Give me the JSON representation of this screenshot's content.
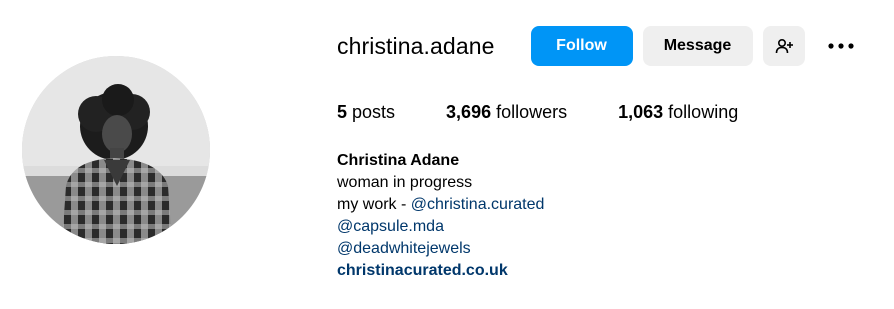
{
  "profile": {
    "username": "christina.adane",
    "display_name": "Christina Adane"
  },
  "actions": {
    "follow_label": "Follow",
    "message_label": "Message",
    "suggest_icon": "person-add-icon",
    "more_icon": "more-options-icon"
  },
  "stats": {
    "posts_count": "5",
    "posts_label": "posts",
    "followers_count": "3,696",
    "followers_label": "followers",
    "following_count": "1,063",
    "following_label": "following"
  },
  "bio": {
    "line1": "woman in progress",
    "line2_prefix": "my work - ",
    "line2_mention": "@christina.curated",
    "mention2": "@capsule.mda",
    "mention3": "@deadwhitejewels",
    "website": "christinacurated.co.uk"
  },
  "colors": {
    "accent": "#0095f6",
    "link": "#00376b",
    "button_secondary": "#efefef"
  }
}
